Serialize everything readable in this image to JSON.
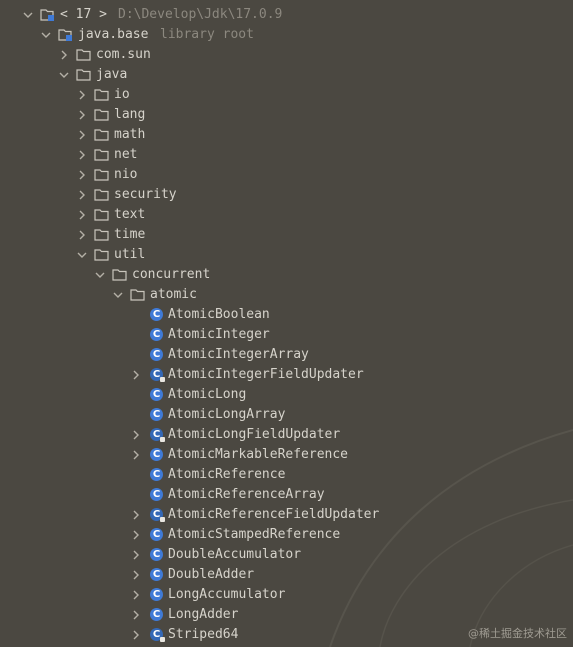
{
  "root": {
    "version": "< 17 >",
    "path": "D:\\Develop\\Jdk\\17.0.9"
  },
  "module": {
    "name": "java.base",
    "hint": "library root"
  },
  "packages": {
    "com_sun": "com.sun",
    "java": "java",
    "java_children": [
      "io",
      "lang",
      "math",
      "net",
      "nio",
      "security",
      "text",
      "time"
    ],
    "util": "util",
    "concurrent": "concurrent",
    "atomic": "atomic"
  },
  "classes": [
    {
      "name": "AtomicBoolean",
      "expandable": false
    },
    {
      "name": "AtomicInteger",
      "expandable": false
    },
    {
      "name": "AtomicIntegerArray",
      "expandable": false
    },
    {
      "name": "AtomicIntegerFieldUpdater",
      "expandable": true
    },
    {
      "name": "AtomicLong",
      "expandable": false
    },
    {
      "name": "AtomicLongArray",
      "expandable": false
    },
    {
      "name": "AtomicLongFieldUpdater",
      "expandable": true
    },
    {
      "name": "AtomicMarkableReference",
      "expandable": true
    },
    {
      "name": "AtomicReference",
      "expandable": false
    },
    {
      "name": "AtomicReferenceArray",
      "expandable": false
    },
    {
      "name": "AtomicReferenceFieldUpdater",
      "expandable": true
    },
    {
      "name": "AtomicStampedReference",
      "expandable": true
    },
    {
      "name": "DoubleAccumulator",
      "expandable": true
    },
    {
      "name": "DoubleAdder",
      "expandable": true
    },
    {
      "name": "LongAccumulator",
      "expandable": true
    },
    {
      "name": "LongAdder",
      "expandable": true
    },
    {
      "name": "Striped64",
      "expandable": true
    }
  ],
  "class_icon_letter": "C",
  "watermark": "@稀土掘金技术社区",
  "colors": {
    "background": "#4b4841",
    "text": "#d6d3cb",
    "muted": "#8c887f",
    "class_icon": "#3f7ad6"
  }
}
